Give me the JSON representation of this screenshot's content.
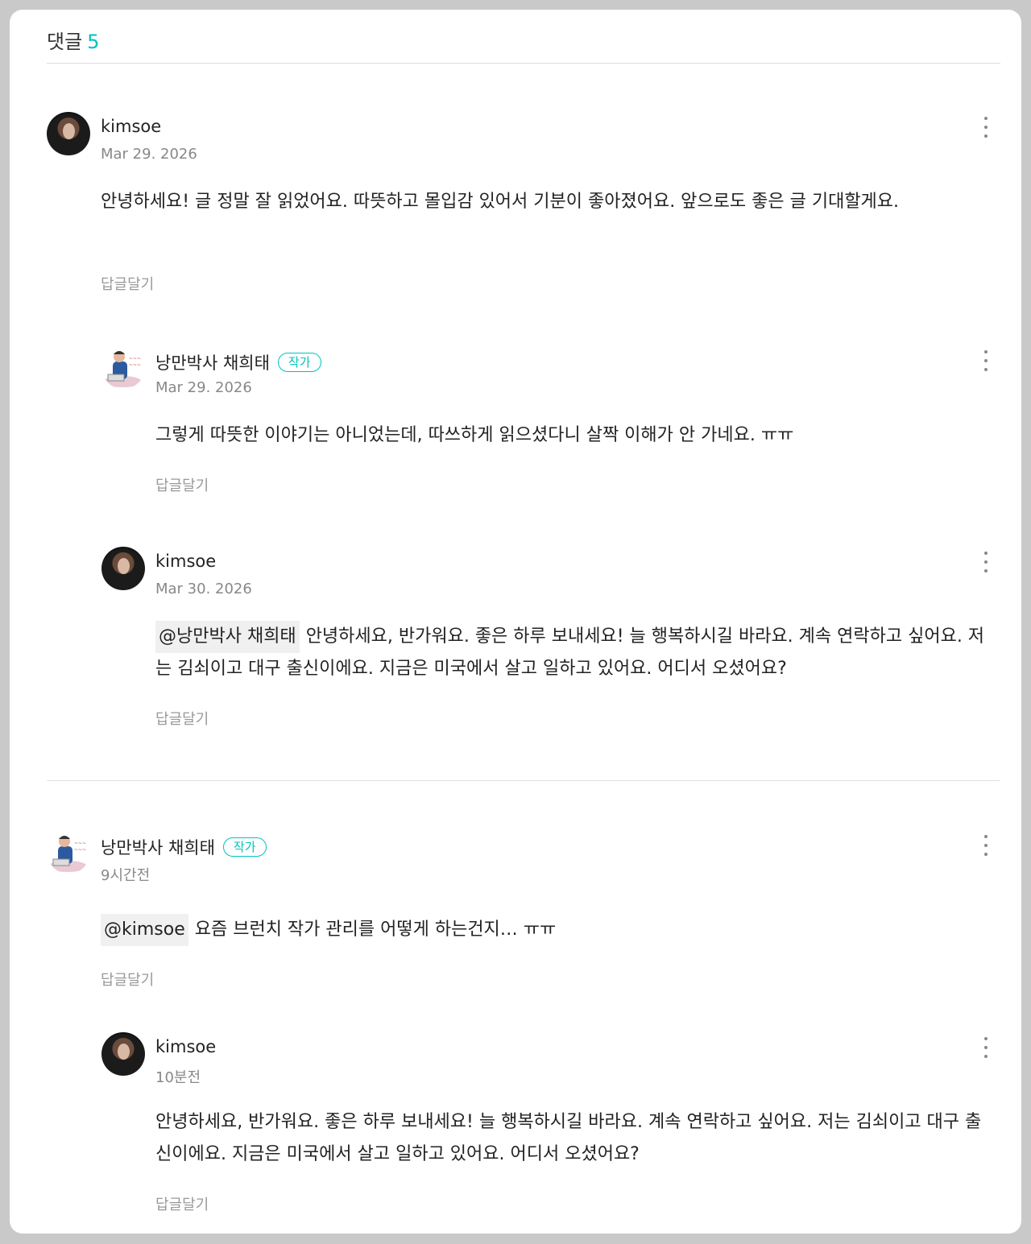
{
  "header": {
    "title": "댓글",
    "count": "5"
  },
  "comments": [
    {
      "author": "kimsoe",
      "date": "Mar 29. 2026",
      "text": "안녕하세요! 글 정말 잘 읽었어요. 따뜻하고 몰입감 있어서 기분이 좋아졌어요. 앞으로도 좋은 글 기대할게요.",
      "reply_label": "답글달기"
    },
    {
      "author": "낭만박사 채희태",
      "badge": "작가",
      "date": "Mar 29. 2026",
      "text": "그렇게 따뜻한 이야기는 아니었는데, 따쓰하게 읽으셨다니 살짝 이해가 안 가네요. ㅠㅠ",
      "reply_label": "답글달기"
    },
    {
      "author": "kimsoe",
      "date": "Mar 30. 2026",
      "mention": "@낭만박사 채희태",
      "text": "안녕하세요, 반가워요. 좋은 하루 보내세요! 늘 행복하시길 바라요. 계속 연락하고 싶어요. 저는 김쇠이고 대구 출신이에요. 지금은 미국에서 살고 일하고 있어요. 어디서 오셨어요?",
      "reply_label": "답글달기"
    },
    {
      "author": "낭만박사 채희태",
      "badge": "작가",
      "date": "9시간전",
      "mention": "@kimsoe",
      "text": "요즘 브런치 작가 관리를 어떻게 하는건지… ㅠㅠ",
      "reply_label": "답글달기"
    },
    {
      "author": "kimsoe",
      "date": "10분전",
      "text": "안녕하세요, 반가워요. 좋은 하루 보내세요! 늘 행복하시길 바라요. 계속 연락하고 싶어요. 저는 김쇠이고 대구 출신이에요. 지금은 미국에서 살고 일하고 있어요. 어디서 오셨어요?",
      "reply_label": "답글달기"
    }
  ]
}
